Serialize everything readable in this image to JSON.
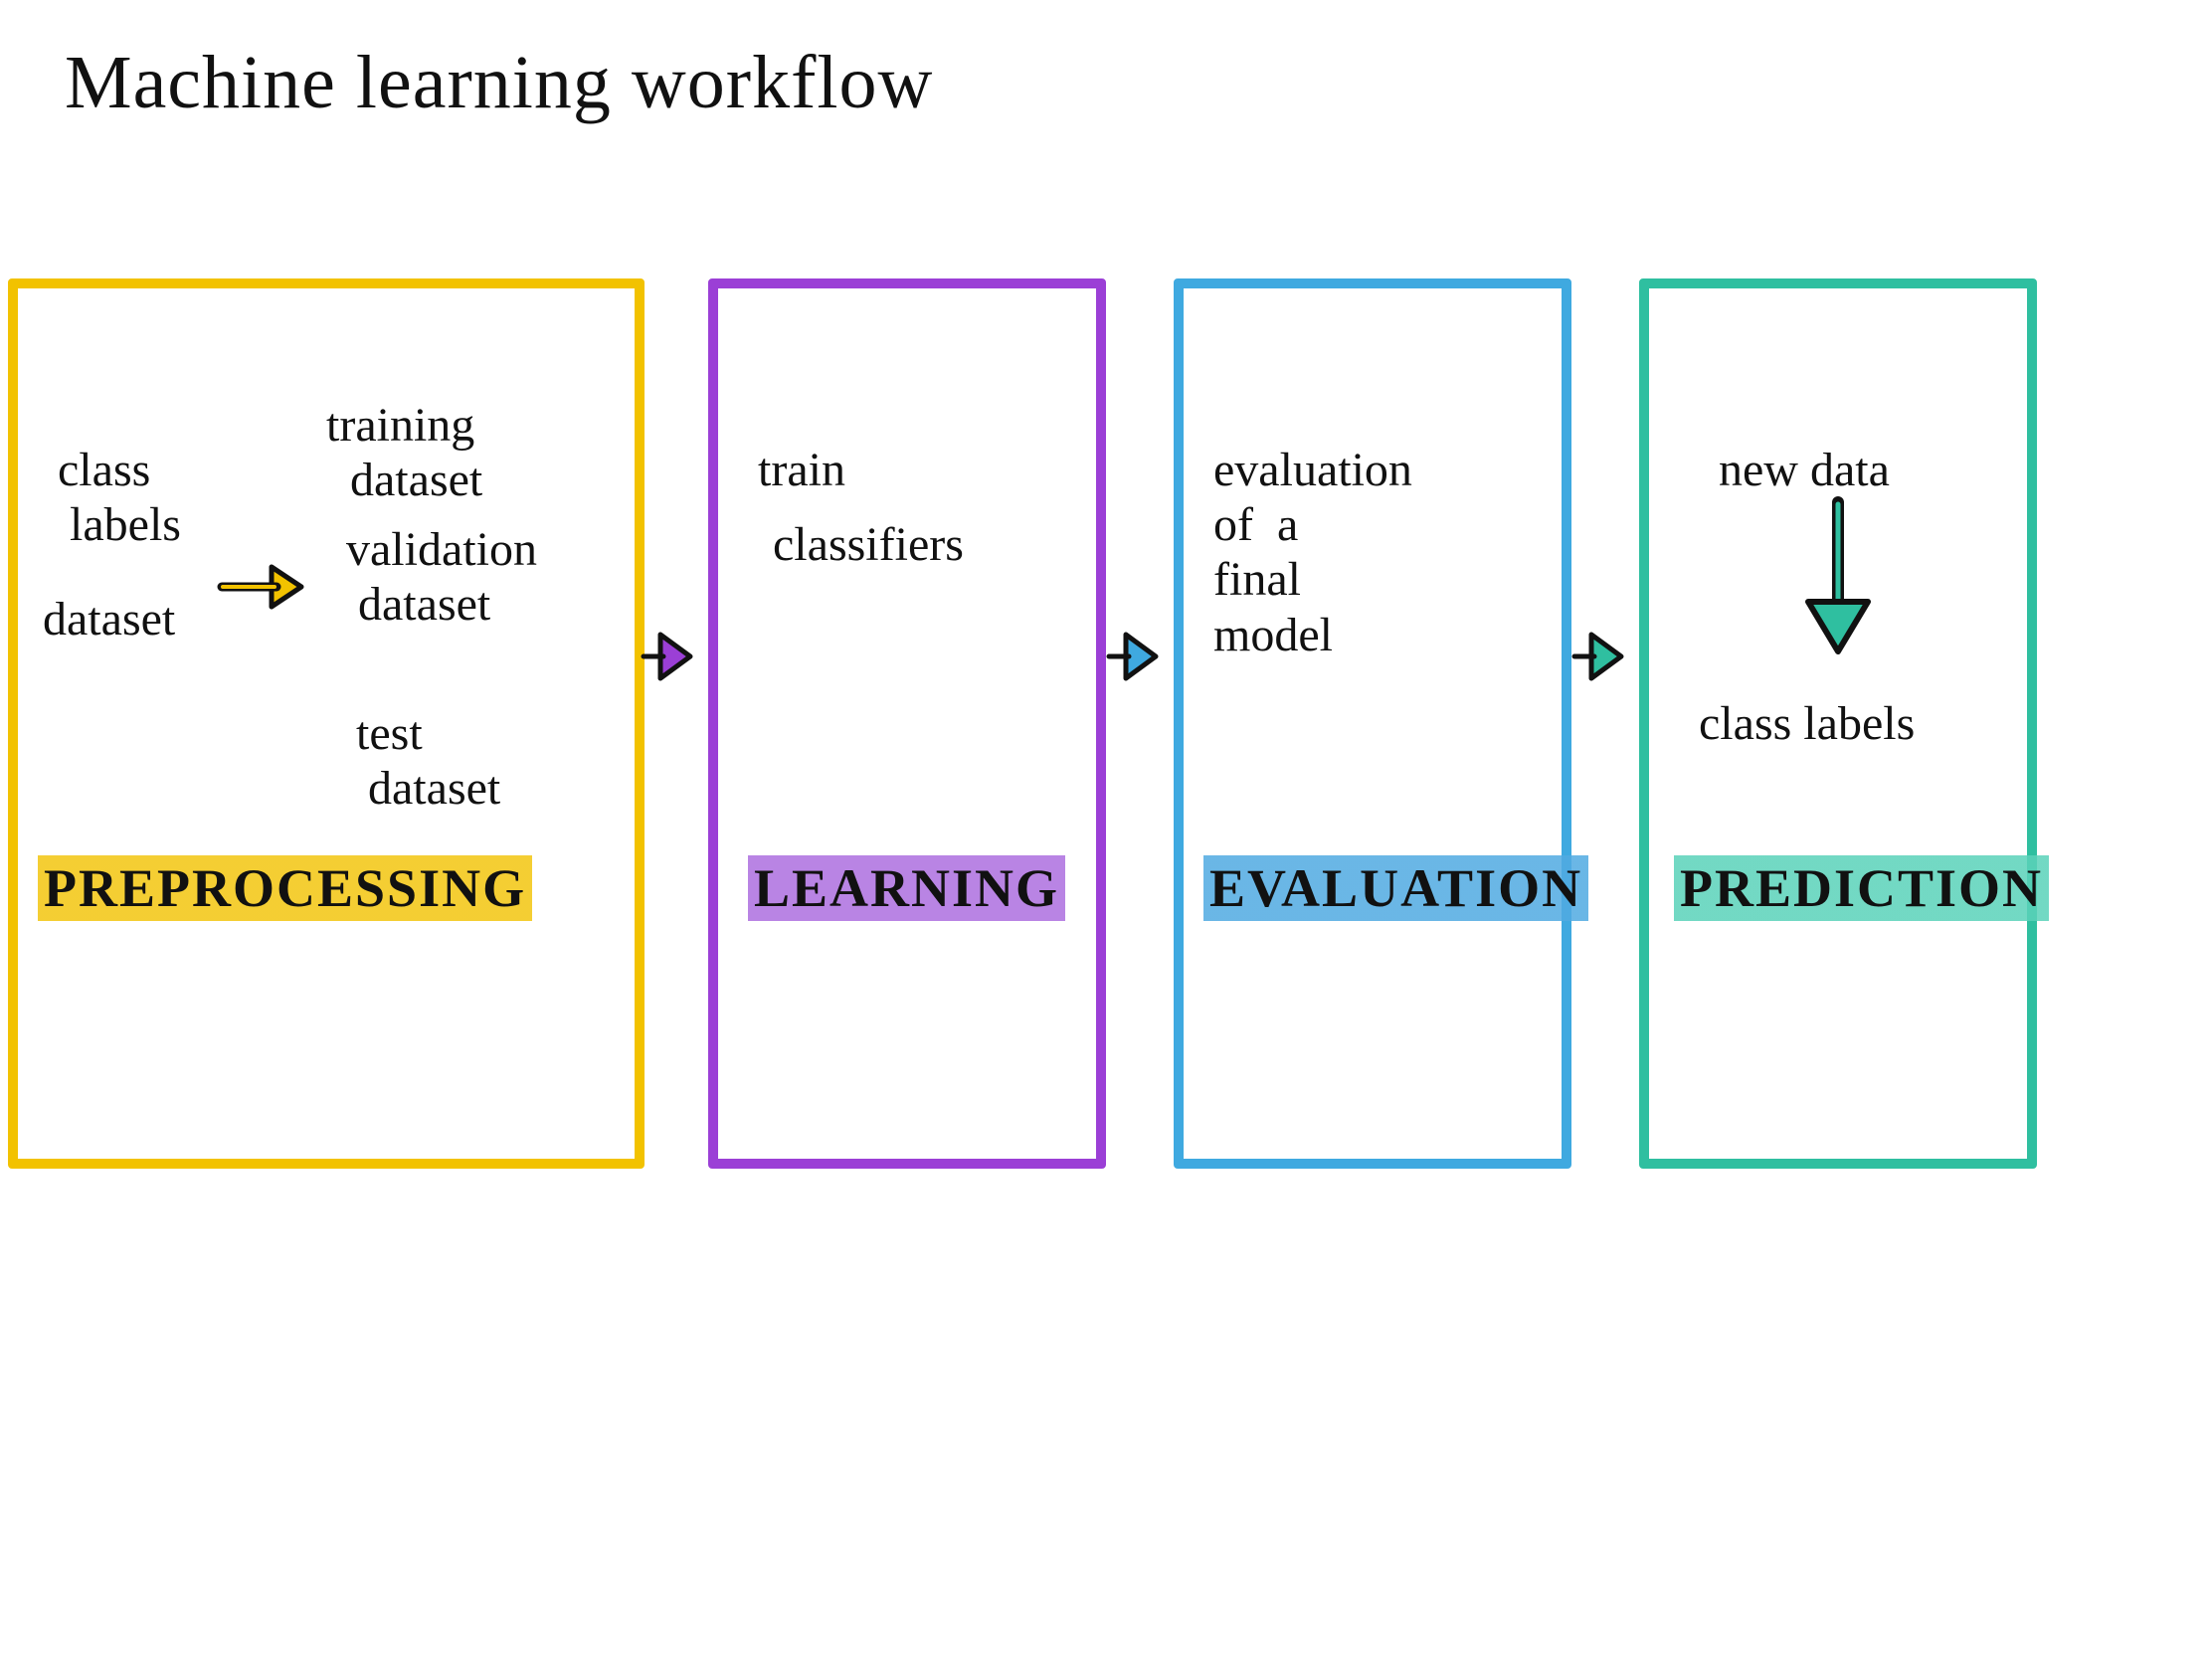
{
  "title": "Machine learning   workflow",
  "colors": {
    "yellow": "#f2c200",
    "purple": "#9b3fd6",
    "blue": "#3fa9e0",
    "teal": "#2fbfa0"
  },
  "stages": [
    {
      "name": "PREPROCESSING",
      "content": {
        "class_labels": "class\n labels",
        "dataset": "dataset",
        "training_dataset": "training\n  dataset",
        "validation_dataset": "validation\n dataset",
        "test_dataset": "test\n dataset"
      }
    },
    {
      "name": "LEARNING",
      "content": {
        "line1": "train",
        "line2": "classifiers"
      }
    },
    {
      "name": "EVALUATION",
      "content": {
        "text": "evaluation\nof  a\nfinal\nmodel"
      }
    },
    {
      "name": "PREDICTION",
      "content": {
        "top": "new data",
        "bottom": "class labels"
      }
    }
  ]
}
